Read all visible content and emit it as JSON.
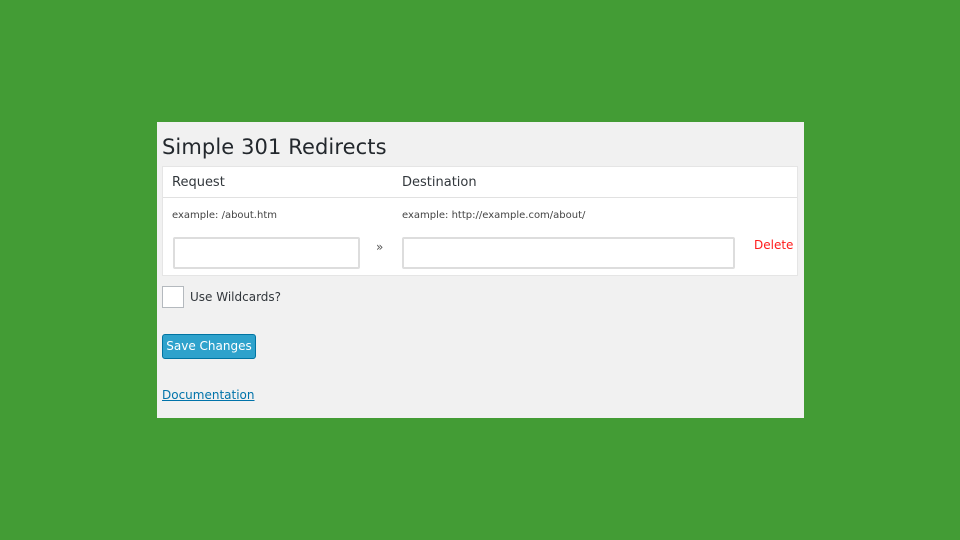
{
  "page": {
    "title": "Simple 301 Redirects"
  },
  "table": {
    "headers": {
      "request": "Request",
      "destination": "Destination"
    },
    "examples": {
      "request": "example: /about.htm",
      "destination": "example: http://example.com/about/"
    },
    "row": {
      "request_value": "",
      "destination_value": "",
      "arrow": "»",
      "delete_label": "Delete"
    }
  },
  "wildcards": {
    "label": "Use Wildcards?",
    "checked": false
  },
  "save_button": {
    "label": "Save Changes"
  },
  "links": {
    "documentation": "Documentation"
  },
  "colors": {
    "background": "#439c35",
    "panel": "#f1f1f1",
    "primary_button": "#2ea2cc",
    "delete": "#ff1a1a",
    "link": "#0073aa"
  }
}
